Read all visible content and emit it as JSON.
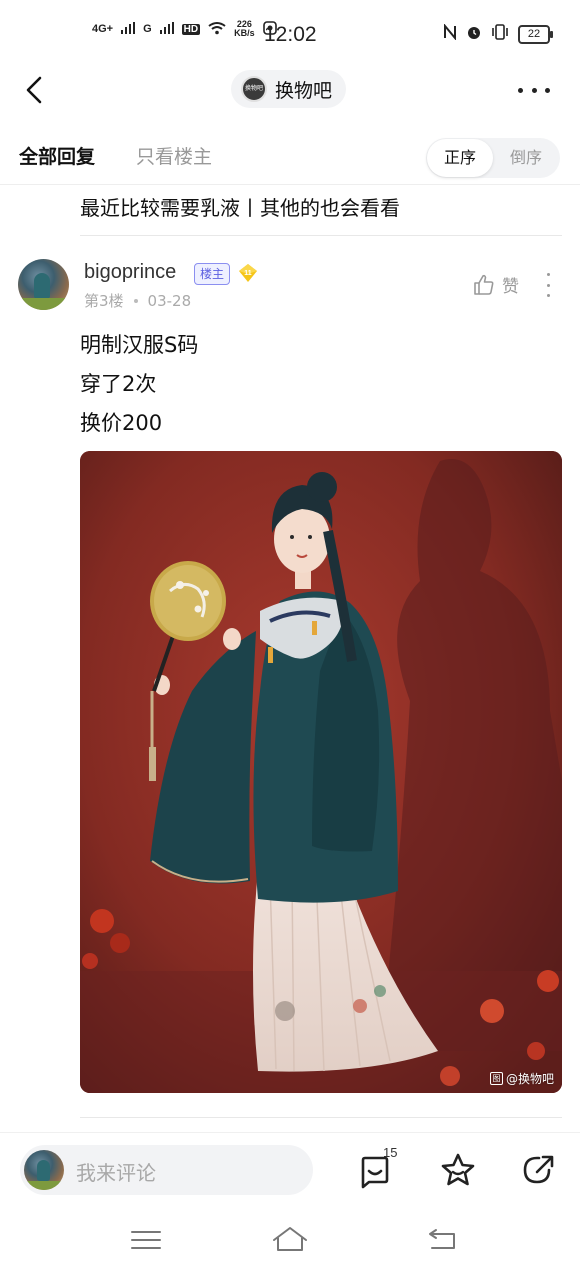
{
  "status_bar": {
    "network_1": "4G+",
    "network_2": "G",
    "hd_label": "HD",
    "speed_value": "226",
    "speed_unit": "KB/s",
    "time": "12:02",
    "battery": "22"
  },
  "header": {
    "forum_name": "换物吧",
    "forum_logo_text": "换物吧"
  },
  "filter": {
    "all_replies": "全部回复",
    "op_only": "只看楼主",
    "sort_ascending": "正序",
    "sort_descending": "倒序",
    "active_sort": "ascending"
  },
  "previous_reply": {
    "text": "最近比较需要乳液丨其他的也会看看"
  },
  "reply": {
    "username": "bigoprince",
    "op_badge": "楼主",
    "level": "11",
    "floor": "第3楼",
    "date": "03-28",
    "like_label": "赞",
    "lines": [
      "明制汉服S码",
      "穿了2次",
      "换价200"
    ],
    "image_watermark": "@换物吧",
    "image_watermark_icon": "图"
  },
  "comment_bar": {
    "placeholder": "我来评论",
    "reply_count": "15"
  },
  "icons": {
    "back": "chevron-left-icon",
    "more": "more-horizontal-icon",
    "like": "thumbs-up-icon",
    "comment": "comment-bubble-icon",
    "favorite": "star-icon",
    "share": "share-icon",
    "nav_menu": "menu-icon",
    "nav_home": "home-icon",
    "nav_back": "back-arrow-icon"
  },
  "colors": {
    "accent_badge": "#5b5fe0",
    "level_badge": "#f5c518",
    "image_background": "#8a2b22",
    "garment": "#1f4a52"
  }
}
